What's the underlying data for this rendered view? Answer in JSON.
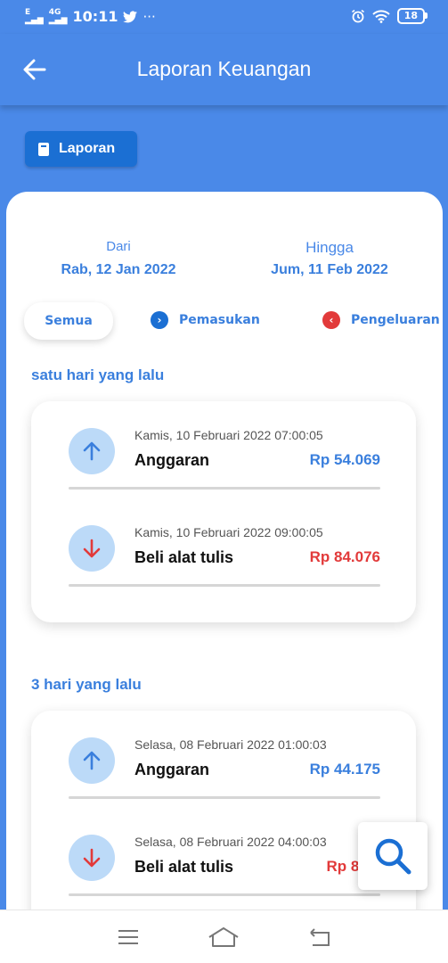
{
  "status_bar": {
    "network_1": "E",
    "network_2": "4G",
    "time": "10:11",
    "extra": "···",
    "battery": "18"
  },
  "app_bar": {
    "title": "Laporan Keuangan",
    "back_icon": "arrow-left-icon"
  },
  "report_button": {
    "label": "Laporan",
    "icon": "book-icon"
  },
  "date_range": {
    "from_label": "Dari",
    "from_value": "Rab, 12 Jan 2022",
    "to_label": "Hingga",
    "to_value": "Jum, 11 Feb 2022"
  },
  "filters": {
    "all": "Semua",
    "income": "Pemasukan",
    "expense": "Pengeluaran"
  },
  "groups": [
    {
      "title": "satu hari yang lalu",
      "items": [
        {
          "datetime": "Kamis, 10 Februari 2022 07:00:05",
          "name": "Anggaran",
          "amount": "Rp 54.069",
          "type": "income"
        },
        {
          "datetime": "Kamis, 10 Februari 2022 09:00:05",
          "name": "Beli alat tulis",
          "amount": "Rp 84.076",
          "type": "expense"
        }
      ]
    },
    {
      "title": "3 hari yang lalu",
      "items": [
        {
          "datetime": "Selasa, 08 Februari 2022 01:00:03",
          "name": "Anggaran",
          "amount": "Rp 44.175",
          "type": "income"
        },
        {
          "datetime": "Selasa, 08 Februari 2022 04:00:03",
          "name": "Beli alat tulis",
          "amount": "Rp 84.5",
          "type": "expense"
        }
      ]
    }
  ],
  "colors": {
    "primary": "#4a89e8",
    "income": "#3a7fdd",
    "expense": "#e23a3a",
    "button": "#1b6fd3"
  }
}
